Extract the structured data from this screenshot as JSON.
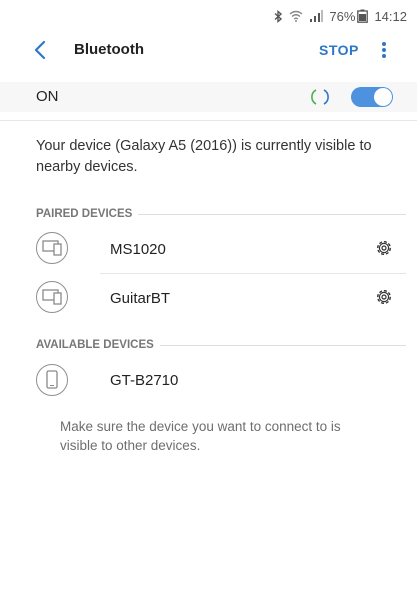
{
  "status_bar": {
    "battery_percent": "76%",
    "time": "14:12",
    "icons": [
      "bluetooth-icon",
      "wifi-icon",
      "signal-icon",
      "battery-icon"
    ]
  },
  "header": {
    "title": "Bluetooth",
    "stop_label": "STOP",
    "more_icon": "more-vertical-icon",
    "back_icon": "back-icon"
  },
  "toggle_row": {
    "label": "ON",
    "state": true
  },
  "visibility_text": "Your device (Galaxy A5 (2016)) is currently visible to nearby devices.",
  "paired_devices": {
    "header": "PAIRED DEVICES",
    "items": [
      {
        "name": "MS1020",
        "icon": "device-icon",
        "action_icon": "gear-icon"
      },
      {
        "name": "GuitarBT",
        "icon": "device-icon",
        "action_icon": "gear-icon"
      }
    ]
  },
  "available_devices": {
    "header": "AVAILABLE DEVICES",
    "items": [
      {
        "name": "GT-B2710",
        "icon": "phone-icon"
      }
    ],
    "hint": "Make sure the device you want to connect to is visible to other devices."
  },
  "colors": {
    "accent": "#2d77c9",
    "toggle_on": "#4c92df",
    "spinner": "#4caf50"
  }
}
